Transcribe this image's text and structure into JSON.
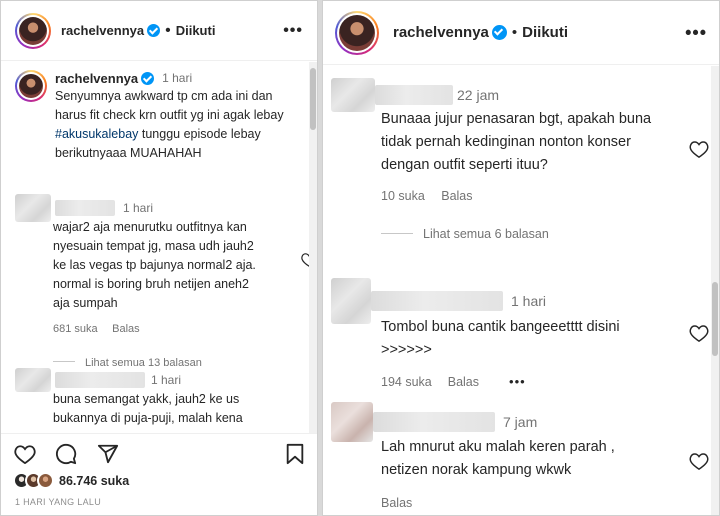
{
  "left": {
    "header": {
      "username": "rachelvennya",
      "dot": "•",
      "follow_label": "Diikuti",
      "more": "•••"
    },
    "caption": {
      "username": "rachelvennya",
      "time": "1 hari",
      "text_before": "Senyumnya awkward tp cm ada ini dan harus fit check krn outfit yg ini agak lebay ",
      "hashtag": "#akusukalebay",
      "text_after": " tunggu episode lebay berikutnyaaa MUAHAHAH"
    },
    "comments": [
      {
        "time": "1 hari",
        "text": "wajar2 aja menurutku outfitnya kan nyesuain tempat jg, masa udh jauh2 ke las vegas tp bajunya normal2 aja. normal is boring bruh netijen aneh2 aja sumpah",
        "likes": "681 suka",
        "reply": "Balas",
        "view_replies": "Lihat semua 13 balasan"
      },
      {
        "time": "1 hari",
        "text": "buna semangat yakk, jauh2 ke us bukannya di puja-puji, malah kena"
      }
    ],
    "likes_count": "86.746 suka",
    "date": "1 HARI YANG LALU"
  },
  "right": {
    "header": {
      "username": "rachelvennya",
      "dot": "•",
      "follow_label": "Diikuti",
      "more": "•••"
    },
    "comments": [
      {
        "time": "22 jam",
        "text": "Bunaaa jujur penasaran bgt, apakah buna tidak pernah kedinginan nonton konser dengan outfit seperti ituu?",
        "likes": "10 suka",
        "reply": "Balas",
        "view_replies": "Lihat semua 6 balasan"
      },
      {
        "time": "1 hari",
        "text": "Tombol buna cantik bangeeetttt disini >>>>>>",
        "likes": "194 suka",
        "reply": "Balas",
        "more": "•••"
      },
      {
        "time": "7 jam",
        "text": "Lah mnurut aku malah keren parah , netizen norak kampung wkwk",
        "reply": "Balas"
      }
    ]
  },
  "icons": [
    "heart-icon",
    "comment-icon",
    "share-icon",
    "bookmark-icon",
    "verified-icon",
    "more-icon"
  ],
  "colors": {
    "text": "#262626",
    "muted": "#737373",
    "verified": "#0095f6",
    "hashtag": "#00376b",
    "divider": "#efefef"
  }
}
